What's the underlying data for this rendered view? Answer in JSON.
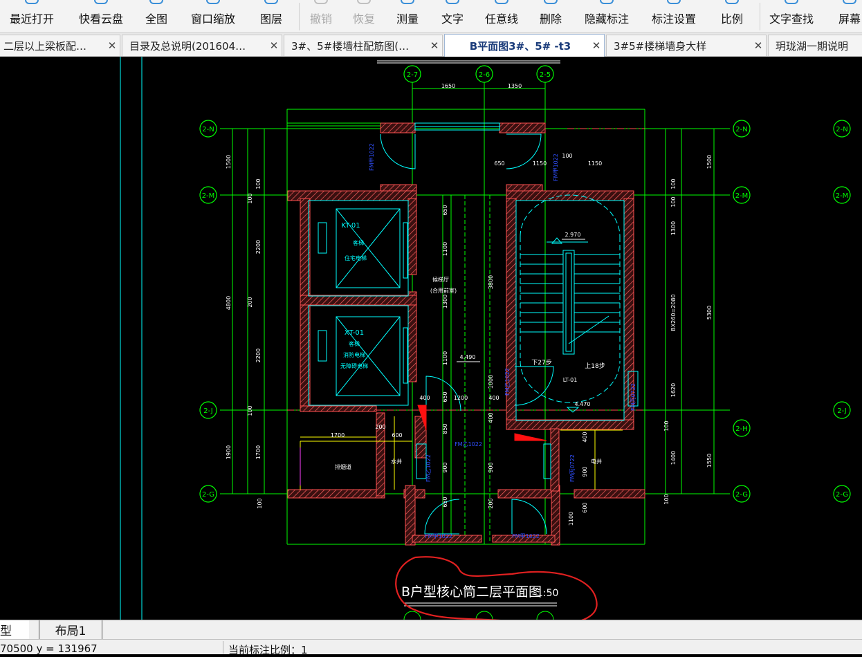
{
  "toolbar": {
    "items": [
      {
        "label": "最近打开",
        "icon": "recent-files-icon",
        "enabled": true
      },
      {
        "label": "快看云盘",
        "icon": "cloud-drive-icon",
        "enabled": true
      },
      {
        "label": "全图",
        "icon": "full-view-icon",
        "enabled": true
      },
      {
        "label": "窗口缩放",
        "icon": "window-zoom-icon",
        "enabled": true
      },
      {
        "label": "图层",
        "icon": "layers-icon",
        "enabled": true
      },
      {
        "label": "撤销",
        "icon": "undo-icon",
        "enabled": false
      },
      {
        "label": "恢复",
        "icon": "redo-icon",
        "enabled": false
      },
      {
        "label": "测量",
        "icon": "measure-icon",
        "enabled": true
      },
      {
        "label": "文字",
        "icon": "text-icon",
        "enabled": true
      },
      {
        "label": "任意线",
        "icon": "freeline-icon",
        "enabled": true
      },
      {
        "label": "删除",
        "icon": "delete-icon",
        "enabled": true
      },
      {
        "label": "隐藏标注",
        "icon": "hide-annotation-icon",
        "enabled": true
      },
      {
        "label": "标注设置",
        "icon": "annotation-settings-icon",
        "enabled": true
      },
      {
        "label": "比例",
        "icon": "scale-icon",
        "enabled": true
      },
      {
        "label": "文字查找",
        "icon": "text-search-icon",
        "enabled": true
      },
      {
        "label": "屏幕",
        "icon": "screen-icon",
        "enabled": true
      }
    ]
  },
  "tabs": [
    {
      "label": "二层以上梁板配…",
      "active": false
    },
    {
      "label": "目录及总说明(201604…",
      "active": false
    },
    {
      "label": "3#、5#楼墙柱配筋图(…",
      "active": false
    },
    {
      "label": "B平面图3#、5# -t3",
      "active": true
    },
    {
      "label": "3#5#楼梯墙身大样",
      "active": false
    },
    {
      "label": "玥珑湖一期说明",
      "active": false
    }
  ],
  "tab_close_glyph": "✕",
  "drawing": {
    "title": "B户型核心筒二层平面图",
    "scale": "1:50",
    "axes_top": [
      "2-7",
      "2-6",
      "2-5"
    ],
    "axes_left": [
      "2-N",
      "2-M",
      "2-J",
      "2-G"
    ],
    "axes_right": [
      "2-N",
      "2-M",
      "2-H",
      "2-G"
    ],
    "axes_far_right": [
      "2-N",
      "2-M",
      "2-J",
      "2-G"
    ],
    "dims_top": [
      "1650",
      "1350"
    ],
    "dims_upper_right": [
      "650",
      "1150",
      "100",
      "1150"
    ],
    "dims_left_outer": [
      "1500",
      "4800",
      "1900"
    ],
    "dims_left_inner": [
      "100",
      "100",
      "2200",
      "200",
      "2200",
      "100",
      "1700",
      "100"
    ],
    "dims_right_outer": [
      "1500",
      "5300",
      "1550"
    ],
    "dims_right_inner": [
      "100",
      "100",
      "1300",
      "BX260=2080",
      "1620",
      "100",
      "1400",
      "100"
    ],
    "dims_corridor": [
      "650",
      "1100",
      "1300",
      "1100",
      "650",
      "850",
      "900",
      "650"
    ],
    "dims_center": [
      "3800",
      "1000",
      "400",
      "900",
      "200"
    ],
    "dims_mid_row": [
      "400",
      "1200",
      "400"
    ],
    "dims_lower_left": [
      "1700",
      "200",
      "600"
    ],
    "dims_lower_right": [
      "400",
      "900",
      "600",
      "1100"
    ],
    "room_labels": {
      "elevator1_code": "KT-01",
      "elevator1_name": "客梯",
      "elevator1_desc": "住宅电梯",
      "elevator2_code": "XT-01",
      "elevator2_name": "客梯",
      "elevator2_desc1": "消防电梯",
      "elevator2_desc2": "无障碍电梯",
      "lobby_name": "候梯厅",
      "lobby_desc": "(合用前室)",
      "stair_code": "LT-01",
      "stair_down": "下27步",
      "stair_up": "上18步",
      "shaft_water": "水井",
      "shaft_electric": "电井",
      "shaft_smoke": "排烟道"
    },
    "elevations": [
      "2.970",
      "4.490",
      "4.470"
    ],
    "door_labels": [
      "FM甲1022",
      "FM甲1022",
      "FM乙1022",
      "FM乙1022",
      "FM乙1022",
      "FM丙0722",
      "FM丙0722",
      "FM甲1022",
      "FM甲1022"
    ]
  },
  "layout_tabs": [
    "型",
    "布局1"
  ],
  "status": {
    "coords": "70500  y = 131967",
    "scale_text": "当前标注比例：1"
  },
  "colors": {
    "wall": "#ff5050",
    "axis": "#00ff00",
    "dim_text": "#ffffff",
    "room": "#00ffff",
    "door_label": "#3050ff",
    "fixture": "#ffff00",
    "annotation": "#e02020"
  }
}
